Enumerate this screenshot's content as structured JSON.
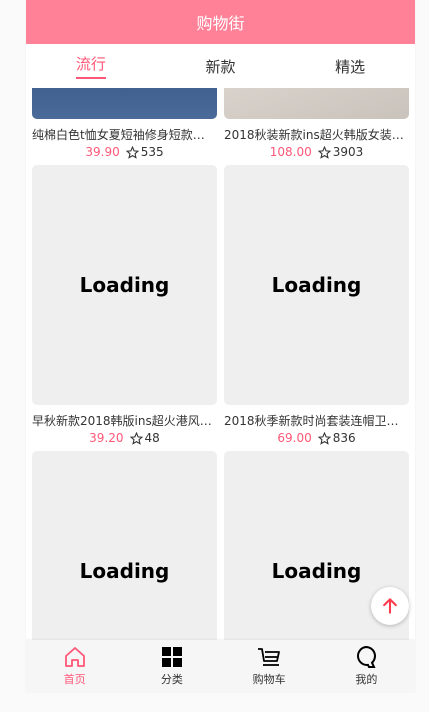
{
  "navbar": {
    "title": "购物街"
  },
  "tabs": [
    {
      "label": "流行",
      "active": true
    },
    {
      "label": "新款",
      "active": false
    },
    {
      "label": "精选",
      "active": false
    }
  ],
  "goods": [
    {
      "title": "纯棉白色t恤女夏短袖修身短款…",
      "price": "39.90",
      "collect": "535",
      "image": "photo"
    },
    {
      "title": "2018秋装新款ins超火韩版女装…",
      "price": "108.00",
      "collect": "3903",
      "image": "photo"
    },
    {
      "title": "早秋新款2018韩版ins超火港风…",
      "price": "39.20",
      "collect": "48",
      "image": "Loading"
    },
    {
      "title": "2018秋季新款时尚套装连帽卫…",
      "price": "69.00",
      "collect": "836",
      "image": "Loading"
    },
    {
      "image": "Loading"
    },
    {
      "image": "Loading"
    }
  ],
  "tabbar": [
    {
      "label": "首页",
      "icon": "home-icon",
      "active": true
    },
    {
      "label": "分类",
      "icon": "category-icon",
      "active": false
    },
    {
      "label": "购物车",
      "icon": "cart-icon",
      "active": false
    },
    {
      "label": "我的",
      "icon": "profile-icon",
      "active": false
    }
  ],
  "colors": {
    "accent": "#ff5777",
    "navbar": "#ff8198"
  }
}
